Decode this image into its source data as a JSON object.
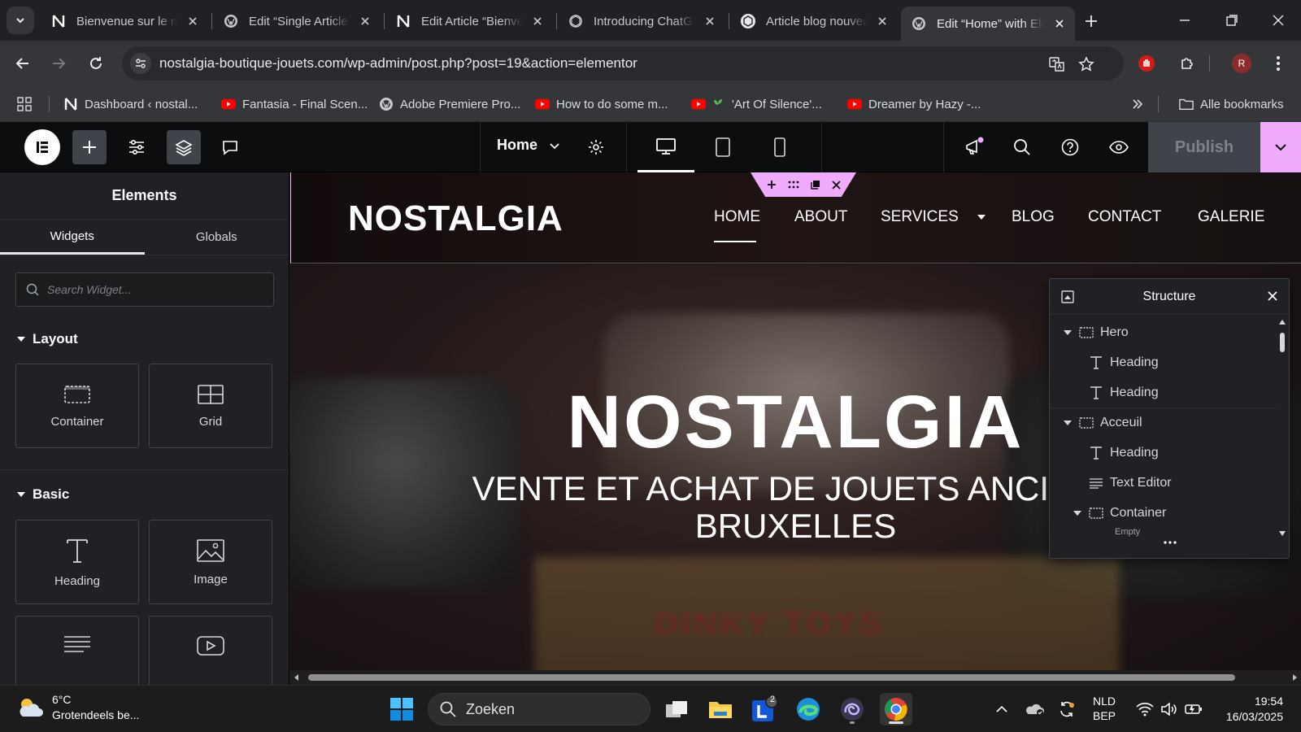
{
  "browser": {
    "tabs": [
      {
        "title": "Bienvenue sur le nouveau",
        "icon": "notion-icon"
      },
      {
        "title": "Edit “Single Article”",
        "icon": "wordpress-icon"
      },
      {
        "title": "Edit Article “Bienvenue",
        "icon": "notion-icon"
      },
      {
        "title": "Introducing ChatGPT",
        "icon": "openai-icon"
      },
      {
        "title": "Article blog nouveau",
        "icon": "openai-icon"
      },
      {
        "title": "Edit “Home” with Elementor",
        "icon": "wordpress-icon",
        "active": true
      }
    ],
    "url": "nostalgia-boutique-jouets.com/wp-admin/post.php?post=19&action=elementor",
    "profile_initial": "R",
    "bookmarks": [
      {
        "label": "Dashboard ‹ nostal...",
        "icon": "notion-icon"
      },
      {
        "label": "Fantasia - Final Scen...",
        "icon": "youtube-icon"
      },
      {
        "label": "Adobe Premiere Pro...",
        "icon": "globe-icon"
      },
      {
        "label": "How to do some m...",
        "icon": "youtube-icon"
      },
      {
        "label": "'Art Of Silence'...",
        "icon": "youtube-icon"
      },
      {
        "label": "Dreamer by Hazy -...",
        "icon": "youtube-icon"
      }
    ],
    "all_bookmarks": "Alle bookmarks"
  },
  "elementor": {
    "page_name": "Home",
    "publish_label": "Publish",
    "accent": "#f0abfc",
    "panel": {
      "title": "Elements",
      "tabs": [
        "Widgets",
        "Globals"
      ],
      "search_placeholder": "Search Widget...",
      "layout_title": "Layout",
      "layout_widgets": [
        "Container",
        "Grid"
      ],
      "basic_title": "Basic",
      "basic_widgets": [
        "Heading",
        "Image"
      ]
    },
    "structure": {
      "title": "Structure",
      "items": [
        {
          "label": "Hero",
          "type": "container"
        },
        {
          "label": "Heading",
          "type": "heading"
        },
        {
          "label": "Heading",
          "type": "heading"
        },
        {
          "label": "Acceuil",
          "type": "container"
        },
        {
          "label": "Heading",
          "type": "heading"
        },
        {
          "label": "Text Editor",
          "type": "text"
        },
        {
          "label": "Container",
          "type": "container"
        },
        {
          "label": "Empty",
          "type": "empty"
        }
      ]
    }
  },
  "site": {
    "logo": "NOSTALGIA",
    "nav": [
      "HOME",
      "ABOUT",
      "SERVICES",
      "BLOG",
      "CONTACT",
      "GALERIE"
    ],
    "hero_title": "NOSTALGIA",
    "hero_subtitle_1": "VENTE ET ACHAT DE JOUETS ANCIENS",
    "hero_subtitle_2": "BRUXELLES",
    "background_box_text": "DINKY TOYS"
  },
  "taskbar": {
    "temperature": "6°C",
    "weather": "Grotendeels be...",
    "search": "Zoeken",
    "badge": "2",
    "lang_1": "NLD",
    "lang_2": "BEP",
    "time": "19:54",
    "date": "16/03/2025"
  }
}
